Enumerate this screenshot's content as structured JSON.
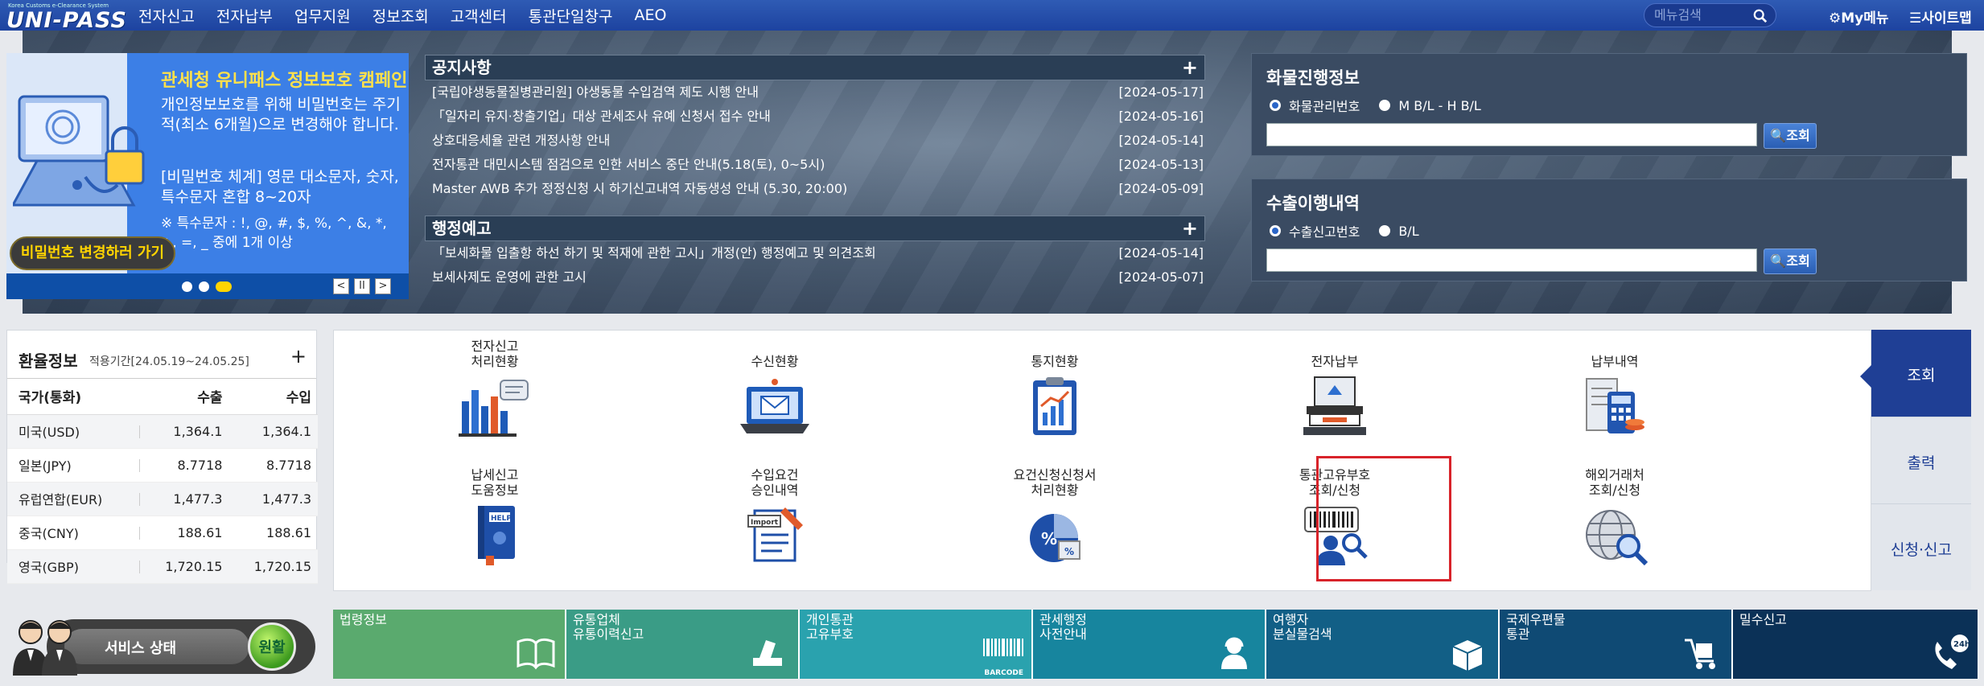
{
  "header": {
    "logo_tagline": "Korea Customs e-Clearance System",
    "logo_text": "UNI-PASS",
    "nav": [
      "전자신고",
      "전자납부",
      "업무지원",
      "정보조회",
      "고객센터",
      "통관단일창구",
      "AEO"
    ],
    "search_placeholder": "메뉴검색",
    "my_menu": "My메뉴",
    "sitemap": "사이트맵"
  },
  "banner": {
    "title": "관세청 유니패스 정보보호 캠페인",
    "text1": "개인정보보호를 위해 비밀번호는 주기적(최소 6개월)으로 변경해야 합니다.",
    "text2": "[비밀번호 체계] 영문 대소문자, 숫자, 특수문자 혼합 8~20자",
    "special": "※ 특수문자 : !, @, #, $, %, ^, &, *, +, =, _  중에 1개 이상",
    "button": "비밀번호 변경하러 가기",
    "dots": 3,
    "active_dot": 3,
    "controls": {
      "prev": "<",
      "pause": "II",
      "next": ">"
    }
  },
  "notices": {
    "title": "공지사항",
    "plus": "+",
    "items": [
      {
        "title": "[국립야생동물질병관리원] 야생동물 수입검역 제도 시행 안내",
        "date": "[2024-05-17]"
      },
      {
        "title": "「일자리 유지·창출기업」대상 관세조사 유예 신청서 접수 안내",
        "date": "[2024-05-16]"
      },
      {
        "title": "상호대응세율 관련 개정사항 안내",
        "date": "[2024-05-14]"
      },
      {
        "title": "전자통관 대민시스템 점검으로 인한 서비스 중단 안내(5.18(토), 0~5시)",
        "date": "[2024-05-13]"
      },
      {
        "title": "Master AWB 추가 정정신청 시 하기신고내역 자동생성 안내 (5.30, 20:00)",
        "date": "[2024-05-09]"
      }
    ]
  },
  "preannounce": {
    "title": "행정예고",
    "plus": "+",
    "items": [
      {
        "title": "「보세화물 입출항 하선 하기 및 적재에 관한 고시」개정(안) 행정예고 및 의견조회",
        "date": "[2024-05-14]"
      },
      {
        "title": "보세사제도 운영에 관한 고시",
        "date": "[2024-05-07]"
      }
    ]
  },
  "cargo": {
    "title": "화물진행정보",
    "options": [
      "화물관리번호",
      "M B/L - H B/L"
    ],
    "selected": 0,
    "value": "",
    "button": "조회"
  },
  "export": {
    "title": "수출이행내역",
    "options": [
      "수출신고번호",
      "B/L"
    ],
    "selected": 0,
    "value": "",
    "button": "조회"
  },
  "fx": {
    "title": "환율정보",
    "period": "적용기간[24.05.19~24.05.25]",
    "plus": "+",
    "columns": [
      "국가(통화)",
      "수출",
      "수입"
    ],
    "rows": [
      {
        "currency": "미국(USD)",
        "export": "1,364.1",
        "import": "1,364.1"
      },
      {
        "currency": "일본(JPY)",
        "export": "8.7718",
        "import": "8.7718"
      },
      {
        "currency": "유럽연합(EUR)",
        "export": "1,477.3",
        "import": "1,477.3"
      },
      {
        "currency": "중국(CNY)",
        "export": "188.61",
        "import": "188.61"
      },
      {
        "currency": "영국(GBP)",
        "export": "1,720.15",
        "import": "1,720.15"
      }
    ]
  },
  "services": [
    {
      "label": "전자신고\n처리현황",
      "icon": "bar-chart-icon"
    },
    {
      "label": "수신현황",
      "icon": "laptop-mail-icon"
    },
    {
      "label": "통지현황",
      "icon": "clipboard-chart-icon"
    },
    {
      "label": "전자납부",
      "icon": "atm-icon"
    },
    {
      "label": "납부내역",
      "icon": "calculator-receipt-icon"
    },
    {
      "label": "납세신고\n도움정보",
      "icon": "help-book-icon"
    },
    {
      "label": "수입요건\n승인내역",
      "icon": "import-document-icon"
    },
    {
      "label": "요건신청신청서\n처리현황",
      "icon": "percent-chart-icon"
    },
    {
      "label": "통관고유부호\n조회/신청",
      "icon": "barcode-person-icon"
    },
    {
      "label": "해외거래처\n조회/신청",
      "icon": "globe-search-icon"
    }
  ],
  "side_tabs": [
    "조회",
    "출력",
    "신청·신고"
  ],
  "service_status": {
    "label": "서비스 상태",
    "state": "원활"
  },
  "quick_links": [
    {
      "label": "법령정보",
      "color": "#5aaa6e",
      "icon": "book-icon"
    },
    {
      "label": "유통업체\n유통이력신고",
      "color": "#3a9c86",
      "icon": "stamp-icon"
    },
    {
      "label": "개인통관\n고유부호",
      "color": "#2aa2ae",
      "icon": "barcode-icon",
      "tag": "BARCODE"
    },
    {
      "label": "관세행정\n사전안내",
      "color": "#17859e",
      "icon": "agent-icon"
    },
    {
      "label": "여행자\n분실물검색",
      "color": "#125f86",
      "icon": "box-icon"
    },
    {
      "label": "국제우편물\n통관",
      "color": "#0f4a74",
      "icon": "cart-icon"
    },
    {
      "label": "밀수신고",
      "color": "#0b3157",
      "icon": "phone-24h-icon",
      "tag": "24h"
    }
  ]
}
